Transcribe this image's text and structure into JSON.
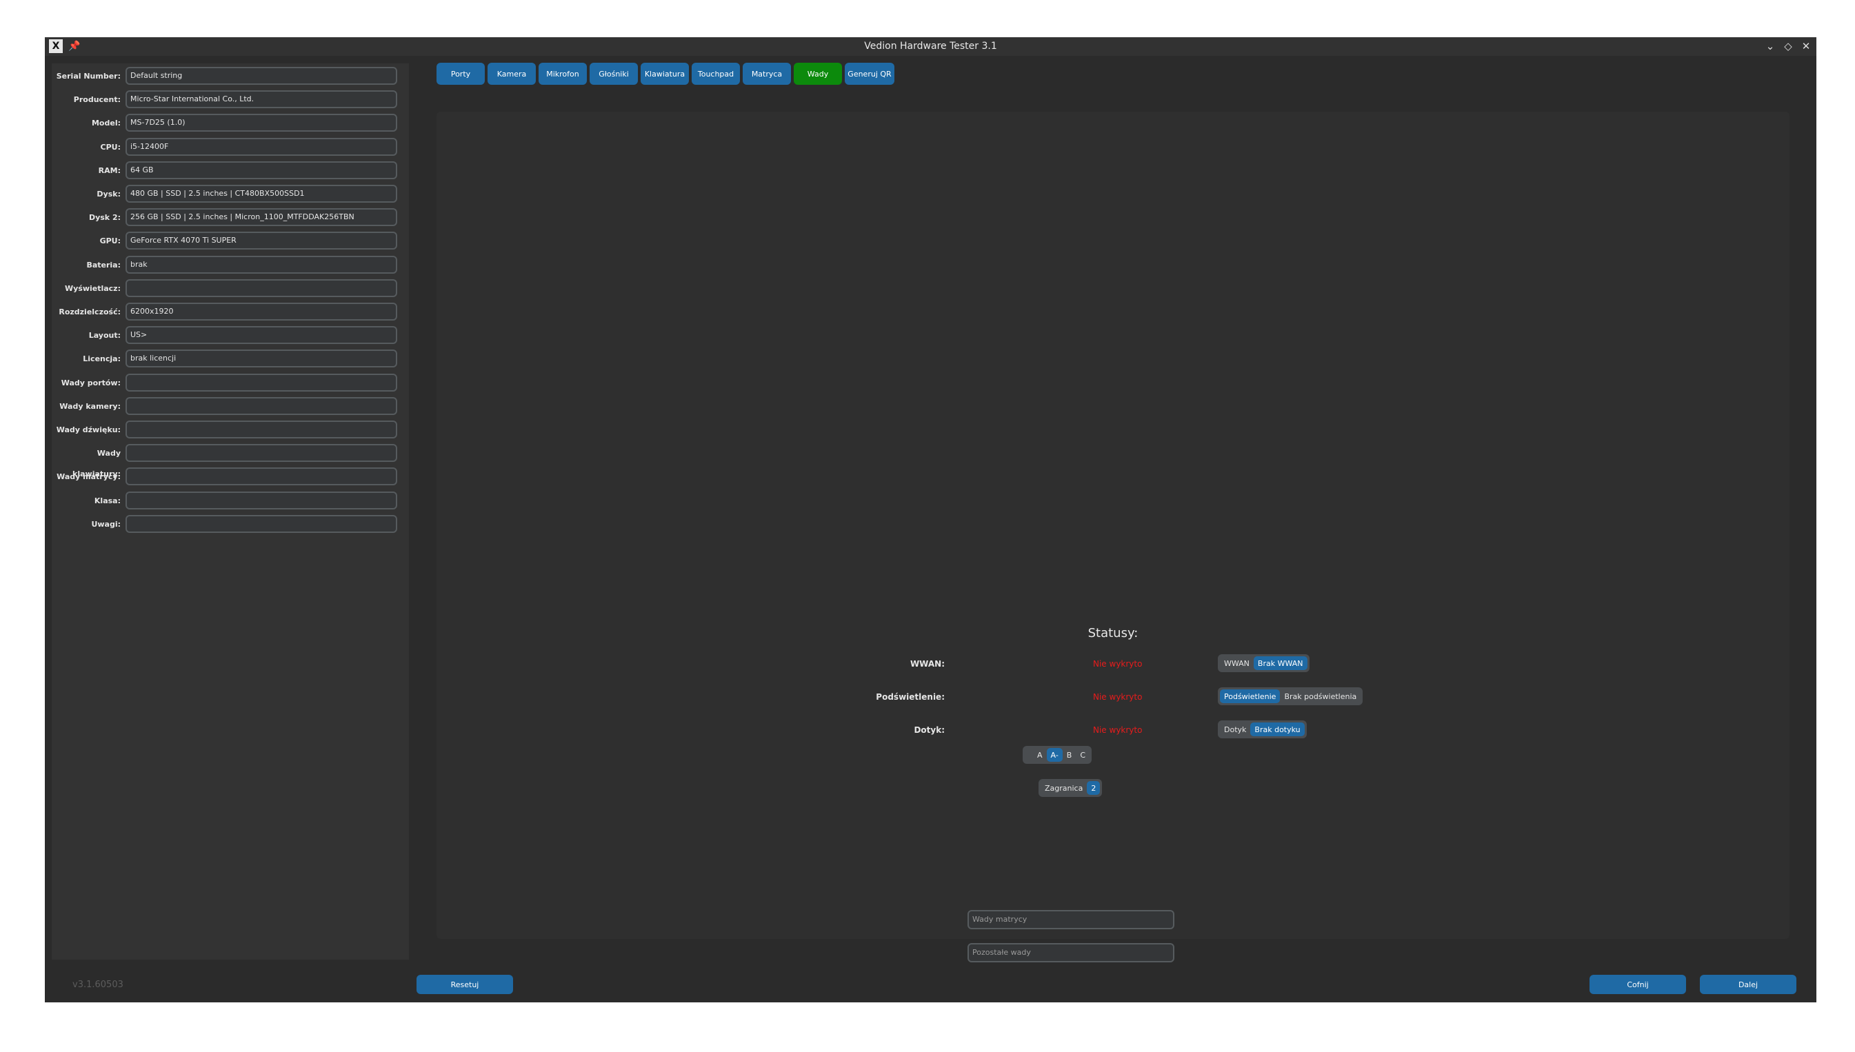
{
  "window": {
    "title": "Vedion Hardware Tester 3.1",
    "app_icon": "X",
    "controls": [
      "minimize-icon",
      "maximize-icon",
      "close-icon"
    ]
  },
  "sidebar": {
    "fields": [
      {
        "label": "Serial Number:",
        "value": "Default string"
      },
      {
        "label": "Producent:",
        "value": "Micro-Star International Co., Ltd."
      },
      {
        "label": "Model:",
        "value": "MS-7D25 (1.0)"
      },
      {
        "label": "CPU:",
        "value": "i5-12400F"
      },
      {
        "label": "RAM:",
        "value": "64 GB"
      },
      {
        "label": "Dysk:",
        "value": "480 GB | SSD | 2.5 inches | CT480BX500SSD1"
      },
      {
        "label": "Dysk 2:",
        "value": "256 GB | SSD | 2.5 inches | Micron_1100_MTFDDAK256TBN"
      },
      {
        "label": "GPU:",
        "value": "GeForce RTX 4070 Ti SUPER"
      },
      {
        "label": "Bateria:",
        "value": "brak"
      },
      {
        "label": "Wyświetlacz:",
        "value": ""
      },
      {
        "label": "Rozdzielczość:",
        "value": "6200x1920"
      },
      {
        "label": "Layout:",
        "value": "US>"
      },
      {
        "label": "Licencja:",
        "value": "brak licencji"
      },
      {
        "label": "Wady portów:",
        "value": ""
      },
      {
        "label": "Wady kamery:",
        "value": ""
      },
      {
        "label": "Wady dźwięku:",
        "value": ""
      },
      {
        "label": "Wady klawiatury:",
        "value": ""
      },
      {
        "label": "Wady matrycy:",
        "value": ""
      },
      {
        "label": "Klasa:",
        "value": ""
      },
      {
        "label": "Uwagi:",
        "value": ""
      }
    ],
    "version": "v3.1.60503",
    "reset_label": "Resetuj"
  },
  "tabs": [
    {
      "label": "Porty",
      "active": false
    },
    {
      "label": "Kamera",
      "active": false
    },
    {
      "label": "Mikrofon",
      "active": false
    },
    {
      "label": "Głośniki",
      "active": false
    },
    {
      "label": "Klawiatura",
      "active": false
    },
    {
      "label": "Touchpad",
      "active": false
    },
    {
      "label": "Matryca",
      "active": false
    },
    {
      "label": "Wady",
      "active": true
    },
    {
      "label": "Generuj QR",
      "active": false
    }
  ],
  "statusy": {
    "title": "Statusy:",
    "rows": [
      {
        "label": "WWAN:",
        "value": "Nie wykryto",
        "options": [
          "WWAN",
          "Brak WWAN"
        ],
        "selected": 1
      },
      {
        "label": "Podświetlenie:",
        "value": "Nie wykryto",
        "options": [
          "Podświetlenie",
          "Brak podświetlenia"
        ],
        "selected": 0
      },
      {
        "label": "Dotyk:",
        "value": "Nie wykryto",
        "options": [
          "Dotyk",
          "Brak dotyku"
        ],
        "selected": 1
      }
    ]
  },
  "grade": {
    "options": [
      "",
      "A",
      "A-",
      "B",
      "C"
    ],
    "selected": 2
  },
  "zagranica": {
    "options": [
      "Zagranica",
      "2"
    ],
    "selected": 1
  },
  "inputs": {
    "wady_matrycy_placeholder": "Wady matrycy",
    "pozostale_wady_placeholder": "Pozostałe wady"
  },
  "footer": {
    "back_label": "Cofnij",
    "next_label": "Dalej"
  },
  "colors": {
    "accent": "#1f6aa5",
    "active_tab": "#0c8a0c",
    "error": "#e81c1c",
    "background": "#2b2b2b"
  }
}
